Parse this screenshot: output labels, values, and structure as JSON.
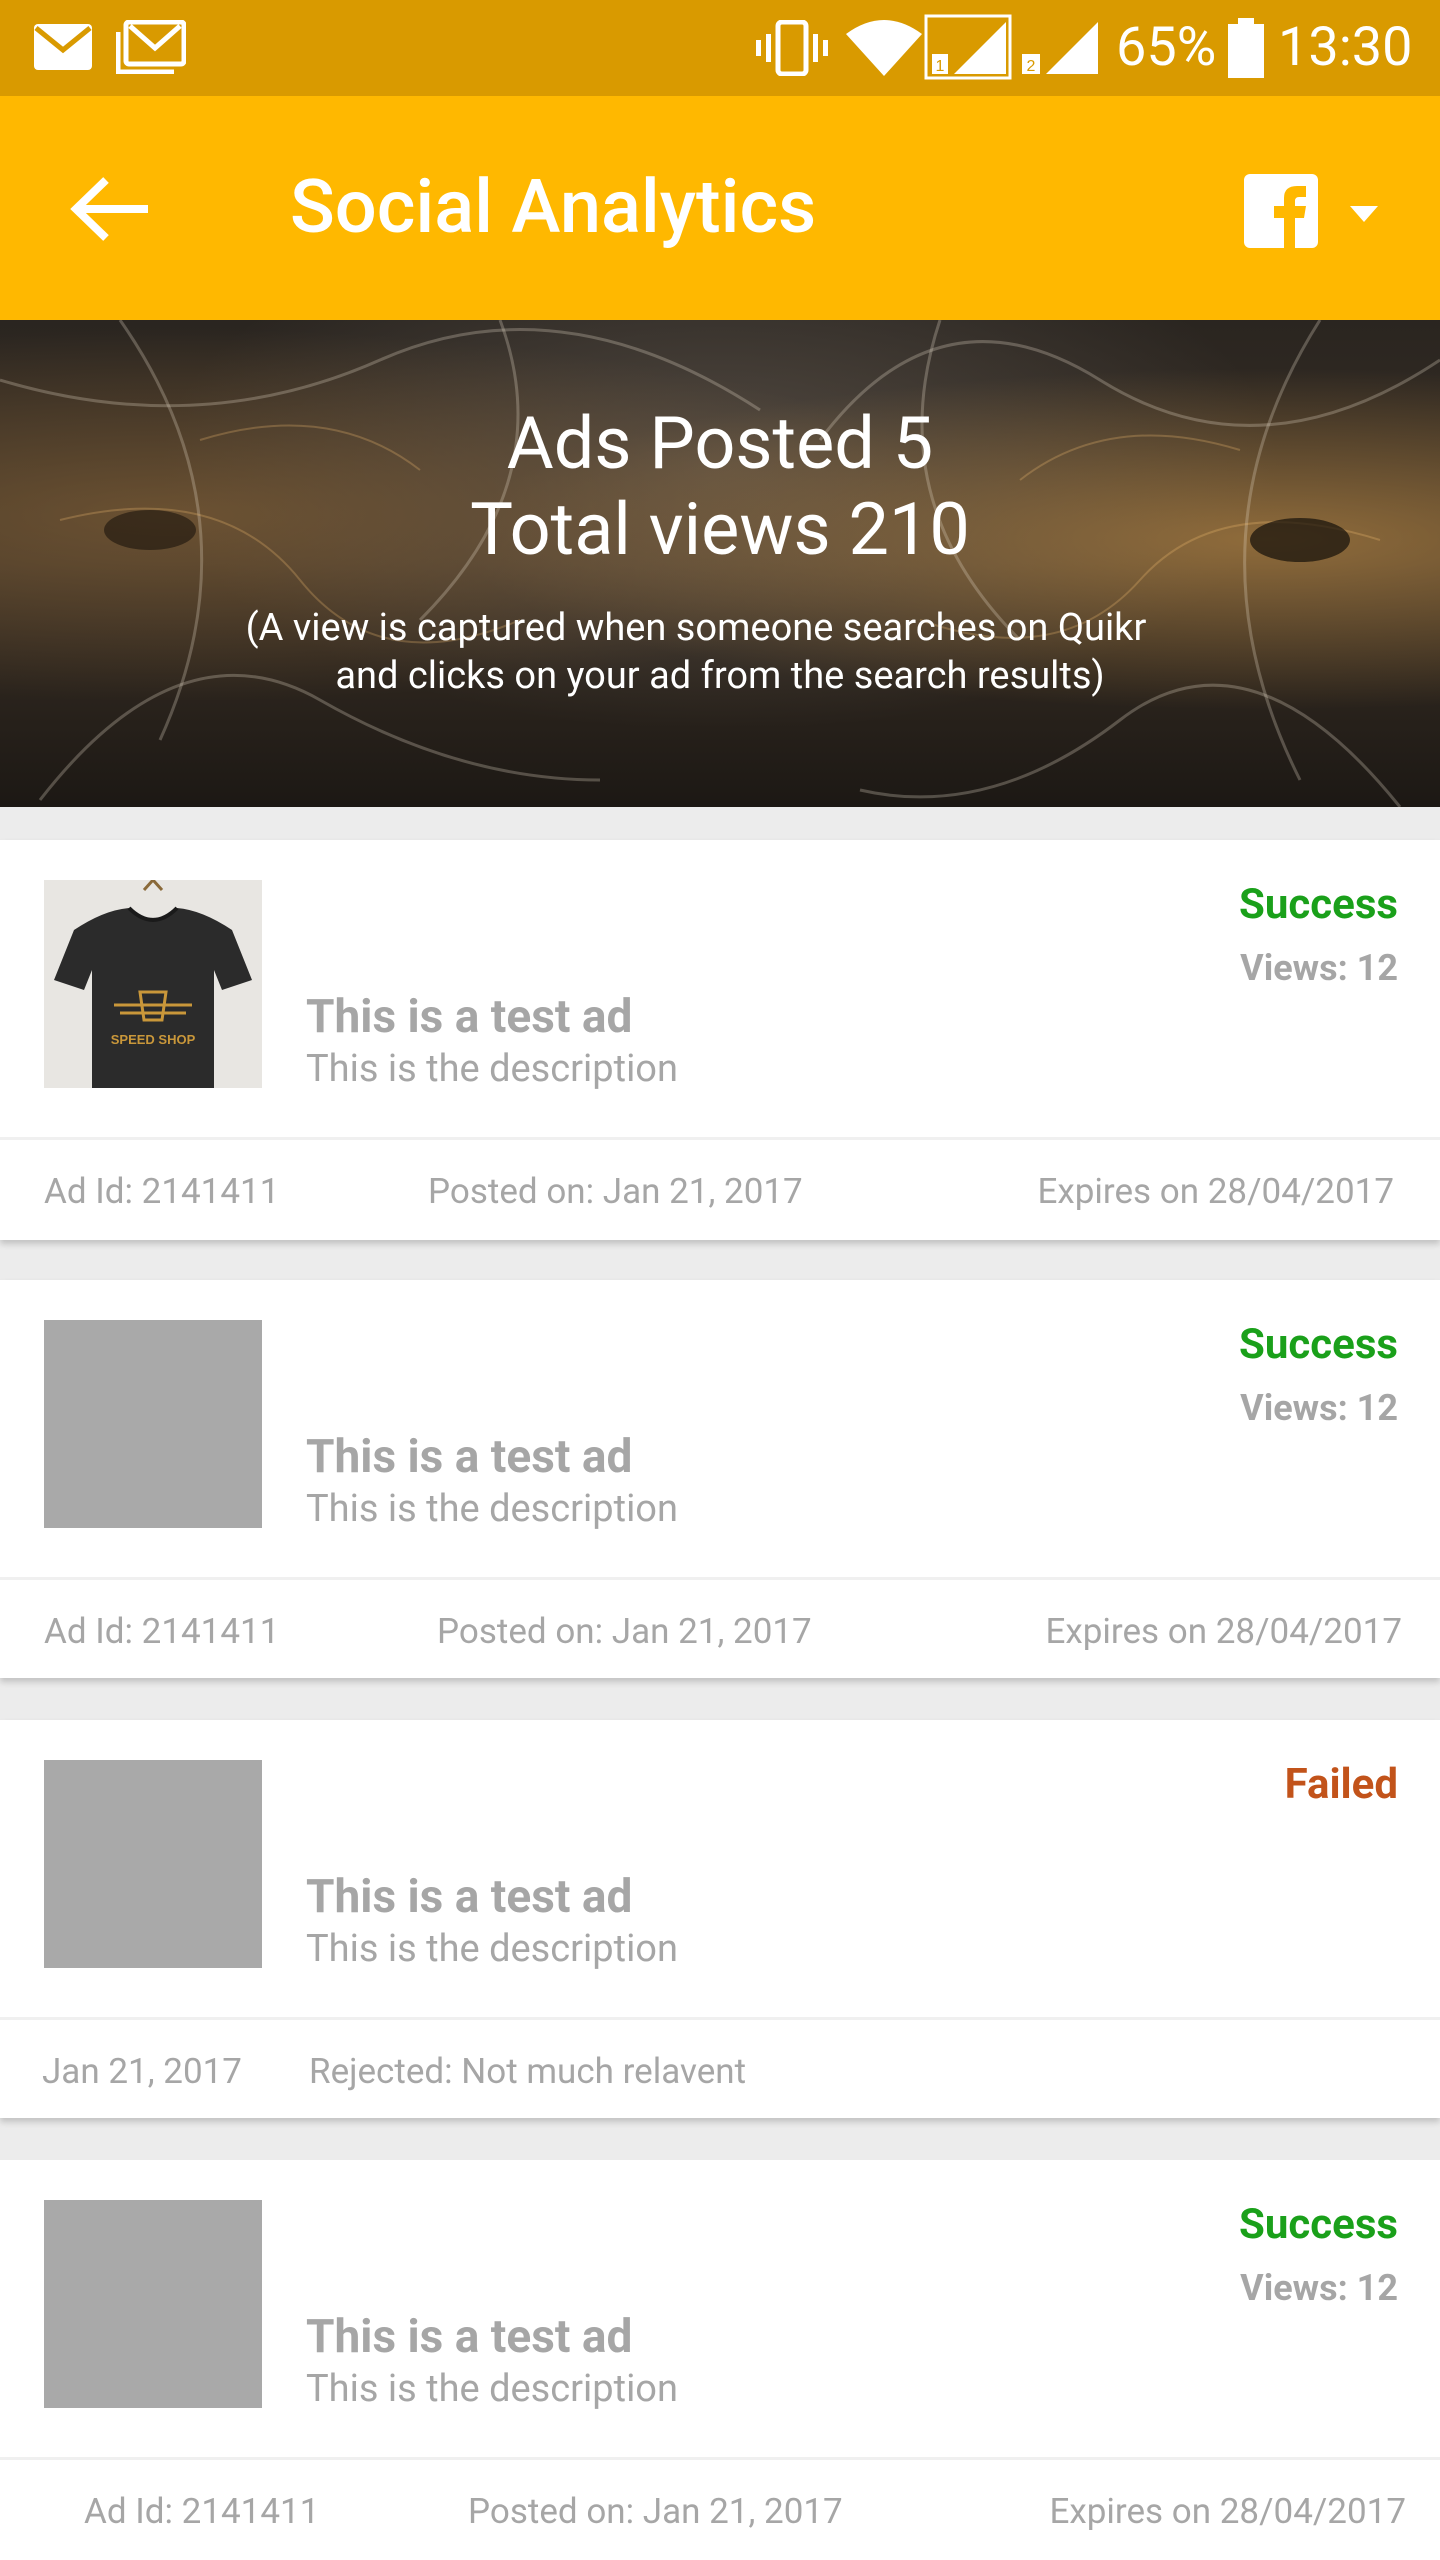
{
  "status_bar": {
    "icons": [
      "email-icon",
      "gmail-icon",
      "vibrate-icon",
      "wifi-icon",
      "signal-sim1-icon",
      "signal-sim2-icon",
      "battery-icon"
    ],
    "battery": "65%",
    "time": "13:30"
  },
  "app_bar": {
    "title": "Social Analytics",
    "back_icon": "arrow-back-icon",
    "account_icon": "facebook-icon",
    "dropdown_icon": "caret-down-icon",
    "color": "#ffb800"
  },
  "hero": {
    "ads_posted": "Ads Posted 5",
    "total_views": "Total views 210",
    "note_line1": "(A view is captured when someone searches on Quikr",
    "note_line2": "and clicks on your ad from the search results)"
  },
  "ads": [
    {
      "thumb": "tshirt",
      "title": "This is a test ad",
      "description": "This is the description",
      "status": "Success",
      "views": "Views: 12",
      "meta": [
        "Ad Id: 2141411",
        "Posted on: Jan 21, 2017",
        "Expires on 28/04/2017"
      ]
    },
    {
      "thumb": "placeholder",
      "title": "This is a test ad",
      "description": "This is the description",
      "status": "Success",
      "views": "Views: 12",
      "meta": [
        "Ad Id: 2141411",
        "Posted on: Jan 21, 2017",
        "Expires on 28/04/2017"
      ]
    },
    {
      "thumb": "placeholder",
      "title": "This is a test ad",
      "description": "This is the description",
      "status": "Failed",
      "views": "",
      "meta": [
        "Jan 21, 2017",
        "Rejected: Not much relavent"
      ]
    },
    {
      "thumb": "placeholder",
      "title": "This is a test ad",
      "description": "This is the description",
      "status": "Success",
      "views": "Views: 12",
      "meta": [
        "Ad Id: 2141411",
        "Posted on: Jan 21, 2017",
        "Expires on 28/04/2017"
      ]
    }
  ],
  "tshirt_print": "SPEED SHOP",
  "colors": {
    "success": "#1aa01a",
    "failed": "#c2531a",
    "muted_text": "#a6a6a6",
    "status_bar": "#d99a00"
  }
}
